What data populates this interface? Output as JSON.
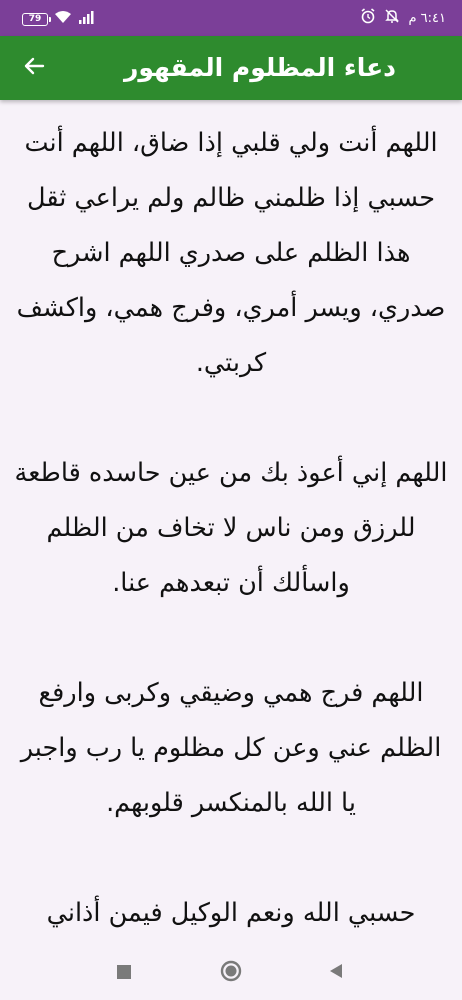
{
  "status_bar": {
    "battery": "79",
    "time": "٦:٤١ م"
  },
  "app_bar": {
    "title": "دعاء المظلوم المقهور",
    "back_icon": "arrow-back-icon"
  },
  "prayers": [
    "اللهم أنت ولي قلبي إذا ضاق، اللهم أنت حسبي إذا ظلمني ظالم ولم يراعي ثقل هذا الظلم على صدري اللهم اشرح صدري، ويسر أمري، وفرج همي، واكشف كربتي.",
    "اللهم إني أعوذ بك من عين حاسده قاطعة للرزق ومن ناس لا تخاف من الظلم واسألك أن تبعدهم عنا.",
    "اللهم فرج همي وضيقي وكربى وارفع الظلم عني وعن كل مظلوم يا رب واجبر يا الله بالمنكسر قلوبهم.",
    "حسبي الله ونعم الوكيل فيمن أذاني"
  ],
  "nav_bar": {
    "recents_icon": "square-icon",
    "home_icon": "circle-icon",
    "back_icon": "triangle-back-icon"
  },
  "colors": {
    "status_bar": "#7b3f98",
    "app_bar": "#2e8b2e",
    "background": "#f7f2f9",
    "text": "#111111"
  }
}
